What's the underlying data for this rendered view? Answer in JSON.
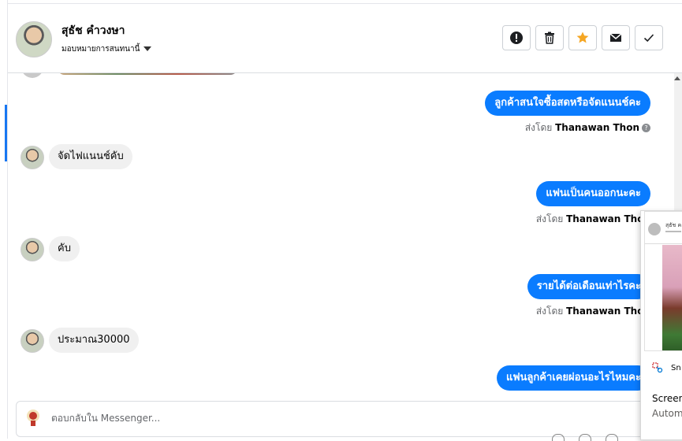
{
  "header": {
    "contact_name": "สุธัช คำวงษา",
    "assign_label": "มอบหมายการสนทนานี้",
    "actions": [
      {
        "icon": "exclamation-icon",
        "label": "Mark as spam"
      },
      {
        "icon": "trash-icon",
        "label": "Delete"
      },
      {
        "icon": "star-icon",
        "label": "Star"
      },
      {
        "icon": "envelope-icon",
        "label": "Mark as unread"
      },
      {
        "icon": "checkmark-icon",
        "label": "Mark as done"
      }
    ],
    "star_color": "#f5a623"
  },
  "messages": [
    {
      "direction": "out",
      "text": "ลูกค้าสนใจซื้อสดหรือจัดแนนช์คะ",
      "sent_by_prefix": "ส่งโดย",
      "sender": "Thanawan Thon"
    },
    {
      "direction": "in",
      "text": "จัดไฟแนนช์คับ"
    },
    {
      "direction": "out",
      "text": "แฟนเป็นคนออกนะคะ",
      "sent_by_prefix": "ส่งโดย",
      "sender": "Thanawan Thon"
    },
    {
      "direction": "in",
      "text": "คับ"
    },
    {
      "direction": "out",
      "text": "รายได้ต่อเดือนเท่าไรคะ",
      "sent_by_prefix": "ส่งโดย",
      "sender": "Thanawan Thon"
    },
    {
      "direction": "in",
      "text": "ประมาณ30000"
    },
    {
      "direction": "out",
      "text": "แฟนลูกค้าเคยผ่อนอะไรไหมคะ"
    }
  ],
  "composer": {
    "placeholder": "ตอบกลับใน Messenger..."
  },
  "notification": {
    "thumb_name": "สุธัช ค",
    "app_label": "Sn",
    "title": "Screen",
    "subtitle": "Autom"
  },
  "colors": {
    "outgoing_bubble": "#0a7cff",
    "incoming_bubble": "#f0f0f0",
    "accent": "#1877f2"
  }
}
